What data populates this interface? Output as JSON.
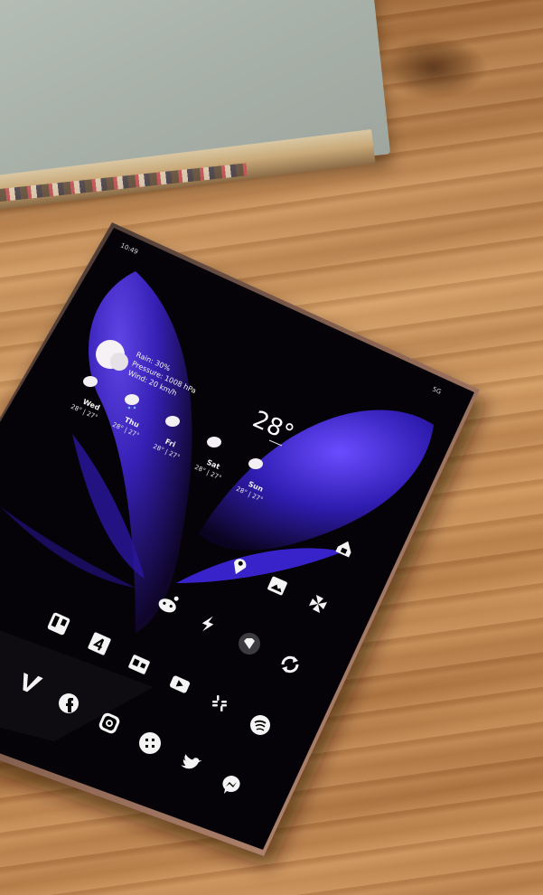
{
  "status": {
    "time": "10:49",
    "right_indicators": "5G"
  },
  "weather": {
    "temperature": "28°",
    "rain": "Rain: 30%",
    "pressure": "Pressure: 1008 hPa",
    "wind": "Wind: 20 km/h",
    "days": [
      {
        "name": "Wed",
        "temp": "28° | 27°"
      },
      {
        "name": "Thu",
        "temp": "28° | 27°"
      },
      {
        "name": "Fri",
        "temp": "28° | 27°"
      },
      {
        "name": "Sat",
        "temp": "28° | 27°"
      },
      {
        "name": "Sun",
        "temp": "28° | 27°"
      }
    ]
  },
  "icons": [
    "home-icon",
    "maps-pin-icon",
    "photos-icon",
    "pinwheel-icon",
    "reddit-icon",
    "trello-icon",
    "widget-4-icon",
    "lightning-icon",
    "vpn-icon",
    "sync-icon",
    "vimeo-icon",
    "translate-icon",
    "youtube-icon",
    "slack-icon",
    "facebook-icon",
    "instagram-icon",
    "grid-app-icon",
    "spotify-icon",
    "twitter-icon",
    "messenger-icon"
  ],
  "colors": {
    "wallpaper_purple": "#4b2fd8",
    "wood": "#c98f57",
    "bezel_bronze": "#b98468"
  }
}
